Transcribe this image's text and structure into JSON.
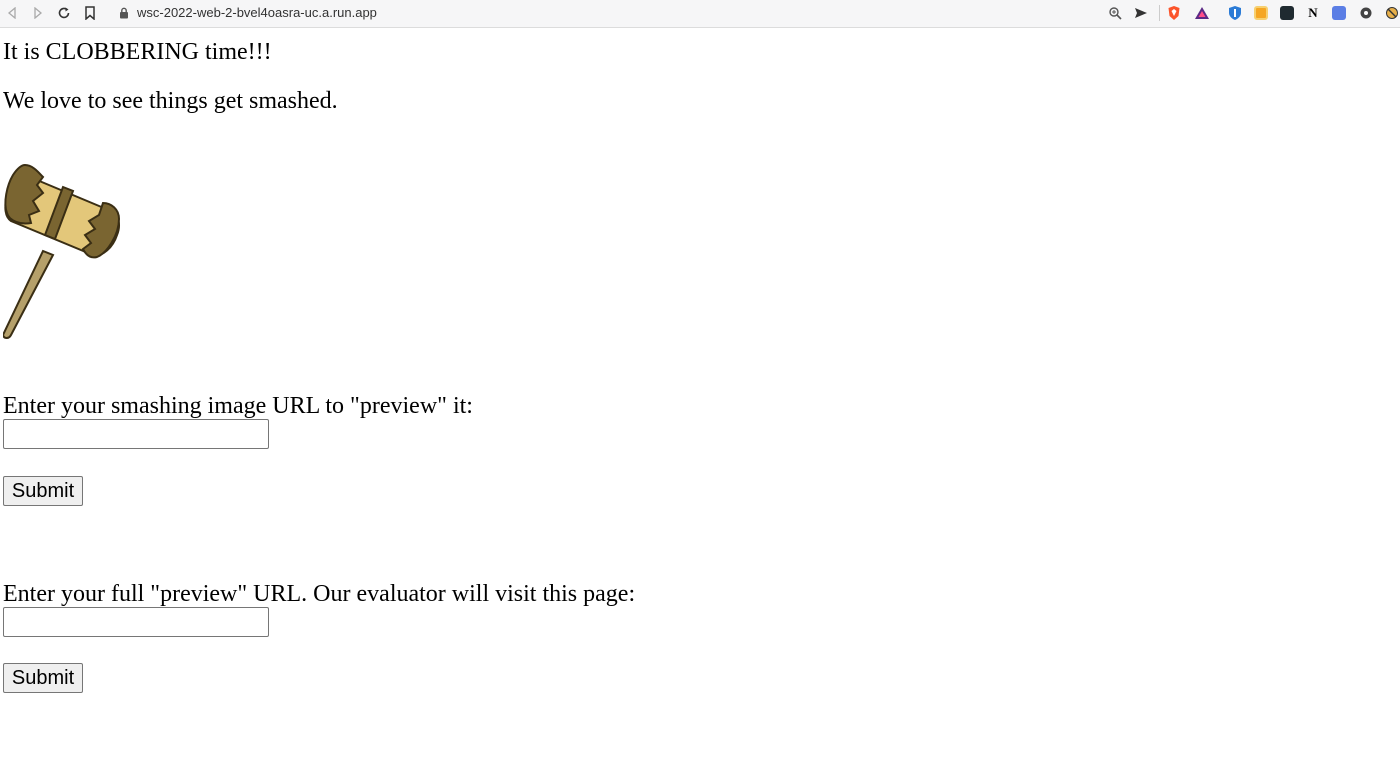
{
  "browser": {
    "url": "wsc-2022-web-2-bvel4oasra-uc.a.run.app"
  },
  "page": {
    "heading": "It is CLOBBERING time!!!",
    "tagline": "We love to see things get smashed.",
    "image": {
      "icon": "mallet-icon"
    },
    "form_preview": {
      "label": "Enter your smashing image URL to \"preview\" it:",
      "value": "",
      "submit_label": "Submit"
    },
    "form_report": {
      "label": "Enter your full \"preview\" URL. Our evaluator will visit this page:",
      "value": "",
      "submit_label": "Submit"
    }
  }
}
